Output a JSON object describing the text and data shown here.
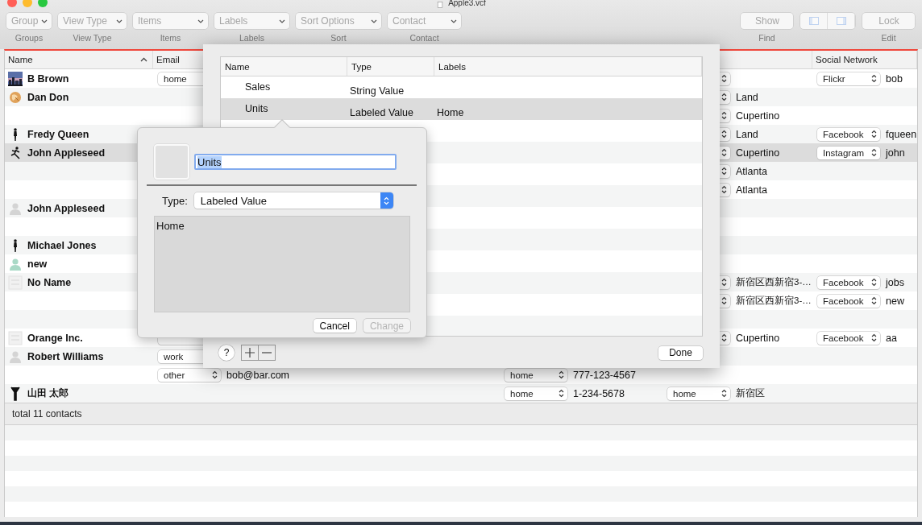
{
  "window": {
    "title": "Apple3.vcf"
  },
  "toolbar": {
    "left": [
      {
        "kind": "popup",
        "control": "Group",
        "caption": "Groups",
        "disabled": true
      },
      {
        "kind": "popup",
        "control": "View Type",
        "caption": "View Type",
        "disabled": true
      },
      {
        "kind": "popup",
        "control": "Items",
        "caption": "Items",
        "disabled": true
      },
      {
        "kind": "popup",
        "control": "Labels",
        "caption": "Labels",
        "disabled": true
      },
      {
        "kind": "popup",
        "control": "Sort Options",
        "caption": "Sort",
        "disabled": true
      },
      {
        "kind": "popup",
        "control": "Contact",
        "caption": "Contact",
        "disabled": true
      }
    ],
    "right": [
      {
        "kind": "button",
        "control": "Show",
        "caption": "Find",
        "disabled": true
      },
      {
        "kind": "segmented",
        "disabled": true
      },
      {
        "kind": "button",
        "control": "Lock",
        "caption": "Edit",
        "disabled": true
      }
    ]
  },
  "table": {
    "columns": [
      {
        "label": "Name",
        "sorted": true
      },
      {
        "label": "Email"
      },
      {
        "label": "Social Network"
      }
    ],
    "rows": [
      {
        "name": "B Brown",
        "selected": false,
        "email": {
          "kind": "popup",
          "label": "home"
        },
        "address": {
          "kind": "popup"
        },
        "social": {
          "kind": "popup",
          "label": "Flickr",
          "value": "bob"
        }
      },
      {
        "name": "Dan Don",
        "kind": "cookie",
        "selected": false,
        "address": {
          "kind": "popup",
          "value": "Land"
        }
      },
      {
        "selected": false,
        "address": {
          "kind": "popup",
          "value": "Cupertino"
        }
      },
      {
        "name": "Fredy Queen",
        "kind": "figure",
        "selected": false,
        "address": {
          "kind": "popup",
          "value": "Land"
        },
        "social": {
          "kind": "popup",
          "label": "Facebook",
          "value": "fqueen"
        }
      },
      {
        "name": "John Appleseed",
        "kind": "runner",
        "selected": true,
        "address": {
          "kind": "popup",
          "value": "Cupertino"
        },
        "social": {
          "kind": "popup",
          "label": "Instagram",
          "value": "john"
        }
      },
      {
        "selected": false,
        "address": {
          "kind": "popup",
          "value": "Atlanta"
        }
      },
      {
        "selected": false,
        "address": {
          "kind": "popup",
          "value": "Atlanta"
        }
      },
      {
        "name": "John Appleseed",
        "kind": "silhouette",
        "selected": false
      },
      {
        "selected": false
      },
      {
        "name": "Michael Jones",
        "kind": "figure",
        "selected": false
      },
      {
        "name": "new",
        "kind": "silhouette-green",
        "selected": false
      },
      {
        "name": "No Name",
        "kind": "logo",
        "selected": false,
        "address": {
          "kind": "popup",
          "value": "新宿区西新宿3-…"
        },
        "social": {
          "kind": "popup",
          "label": "Facebook",
          "value": "jobs"
        }
      },
      {
        "selected": false,
        "address": {
          "kind": "popup",
          "value": "新宿区西新宿3-…"
        },
        "social": {
          "kind": "popup",
          "label": "Facebook",
          "value": "new"
        }
      },
      {
        "selected": false
      },
      {
        "name": "Orange Inc.",
        "kind": "logo",
        "selected": false,
        "email": {
          "kind": "popup"
        },
        "address": {
          "kind": "popup",
          "value": "Cupertino"
        },
        "social": {
          "kind": "popup",
          "label": "Facebook",
          "value": "aa"
        }
      },
      {
        "name": "Robert Williams",
        "kind": "silhouette",
        "selected": false,
        "email": {
          "kind": "popup",
          "label": "work"
        }
      },
      {
        "selected": false,
        "email": {
          "kind": "popup",
          "label": "other",
          "value": "bob@bar.com"
        },
        "phone": {
          "kind": "popup",
          "label": "home",
          "value": "777-123-4567"
        }
      },
      {
        "name": "山田 太郎",
        "kind": "arms-up",
        "selected": false,
        "phone": {
          "kind": "popup",
          "label": "home",
          "value": "1-234-5678"
        },
        "address": {
          "kind": "popup",
          "label": "home",
          "value": "新宿区"
        }
      }
    ],
    "status": "total 11 contacts"
  },
  "sheet": {
    "columns": [
      "Name",
      "Type",
      "Labels"
    ],
    "rows": [
      {
        "name": "Sales",
        "type": "String Value",
        "selected": false
      },
      {
        "name": "Units",
        "type": "Labeled Value",
        "labels": "Home",
        "selected": true
      }
    ],
    "help": "?",
    "done": "Done"
  },
  "popover": {
    "name_field": {
      "value": "Units",
      "text_selected": true
    },
    "type_label": "Type:",
    "type_value": "Labeled Value",
    "labels_text": "Home",
    "buttons": [
      {
        "label": "Cancel",
        "disabled": false
      },
      {
        "label": "Change",
        "disabled": true
      }
    ]
  }
}
